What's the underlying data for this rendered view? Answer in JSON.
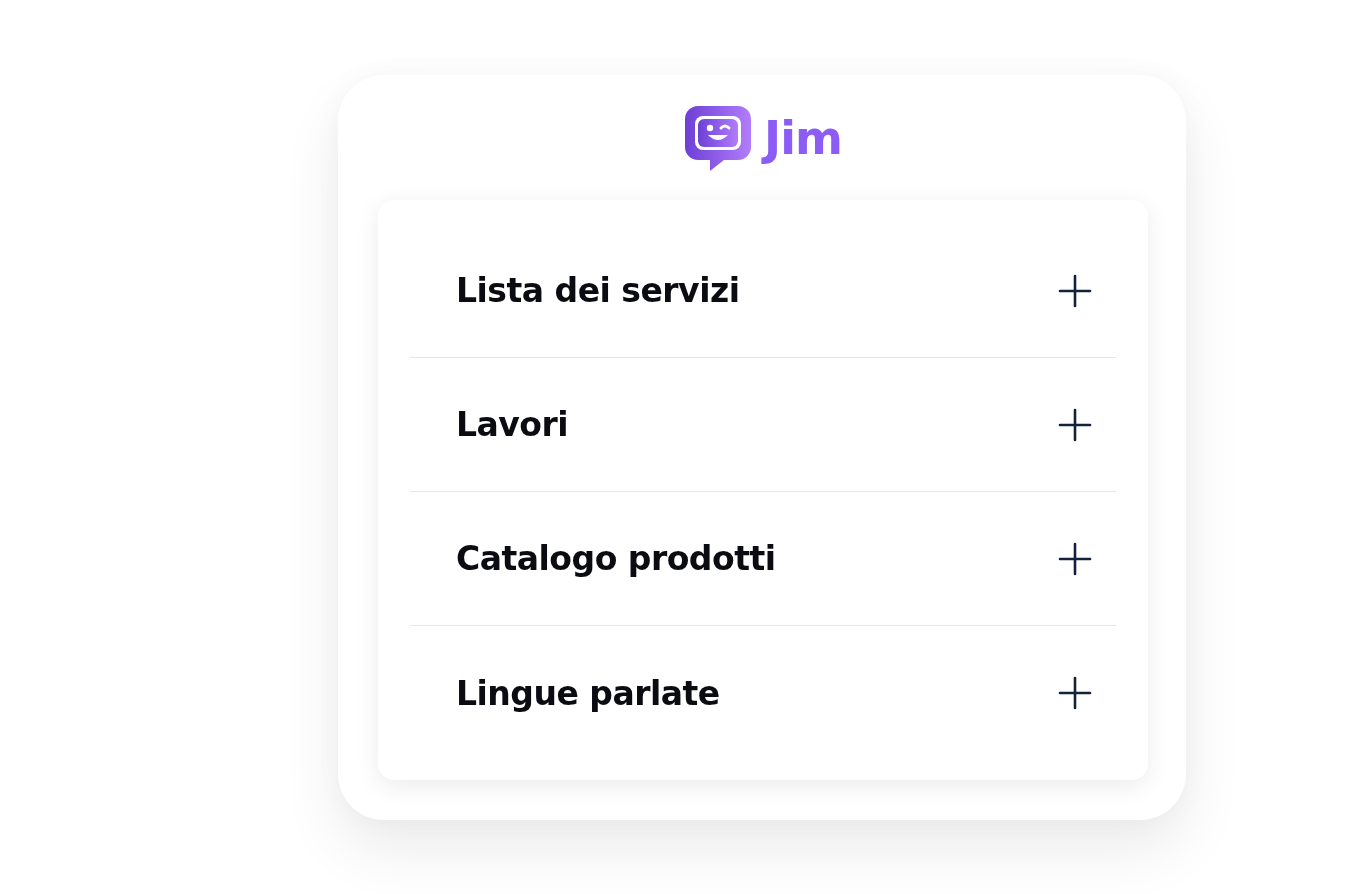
{
  "logo": {
    "name": "Jim"
  },
  "accordion": [
    {
      "label": "Lista dei servizi",
      "expanded": false
    },
    {
      "label": "Lavori",
      "expanded": false
    },
    {
      "label": "Catalogo prodotti",
      "expanded": false
    },
    {
      "label": "Lingue parlate",
      "expanded": false
    }
  ]
}
